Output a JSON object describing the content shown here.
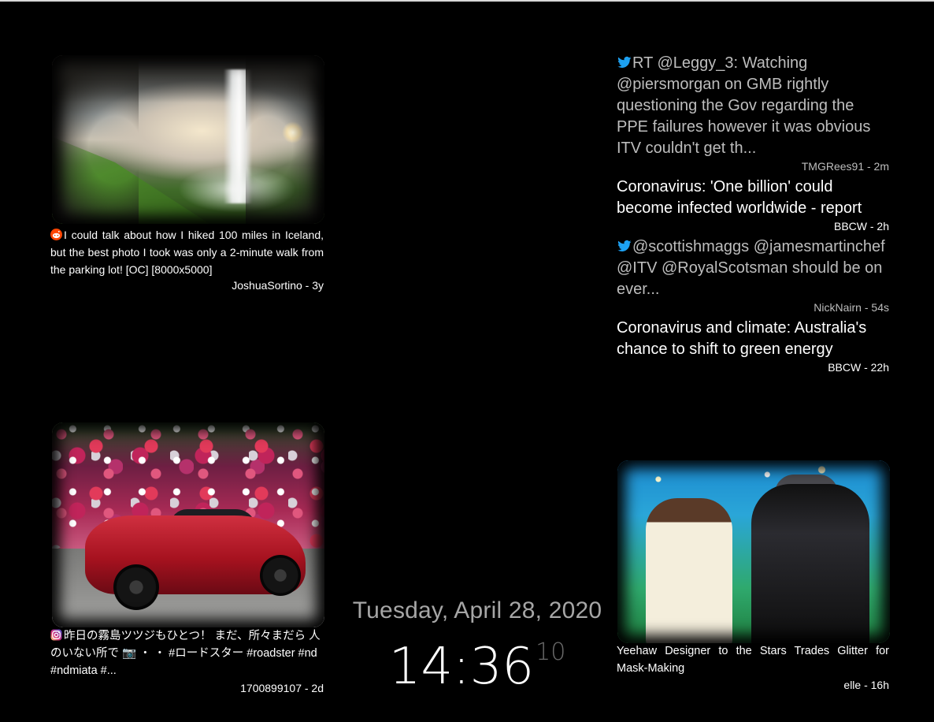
{
  "reddit_card": {
    "icon": "reddit-icon",
    "text": "I could talk about how I hiked 100 miles in Iceland, but the best photo I took was only a 2-minute walk from the parking lot! [OC] [8000x5000]",
    "meta": "JoshuaSortino - 3y"
  },
  "instagram_card": {
    "icon": "instagram-icon",
    "text": "昨日の霧島ツツジもひとつ！ まだ、所々まだら 人のいない所で 📷 ・ ・ #ロードスター #roadster #nd #ndmiata #...",
    "meta": "1700899107 - 2d"
  },
  "news_card": {
    "text": "Yeehaw Designer to the Stars Trades Glitter for Mask-Making",
    "meta": "elle - 16h"
  },
  "clock": {
    "date": "Tuesday, April 28, 2020",
    "time": "14:36",
    "seconds": "10"
  },
  "feed": [
    {
      "icon": "twitter-icon",
      "text": "RT @Leggy_3: Watching @piersmorgan on GMB rightly questioning the Gov regarding the PPE failures however it was obvious ITV couldn't get th...",
      "meta": "TMGRees91 - 2m"
    },
    {
      "icon": "",
      "text": "Coronavirus: 'One billion' could become infected worldwide - report",
      "meta": "BBCW - 2h"
    },
    {
      "icon": "twitter-icon",
      "text": "@scottishmaggs @jamesmartinchef @ITV @RoyalScotsman should be on ever...",
      "meta": "NickNairn - 54s"
    },
    {
      "icon": "",
      "text": "Coronavirus and climate: Australia's chance to shift to green energy",
      "meta": "BBCW - 22h"
    }
  ],
  "colors": {
    "background": "#000000",
    "twitter_blue": "#1da1f2",
    "reddit_orange": "#ff4500",
    "muted_text": "#bdbdbd"
  }
}
